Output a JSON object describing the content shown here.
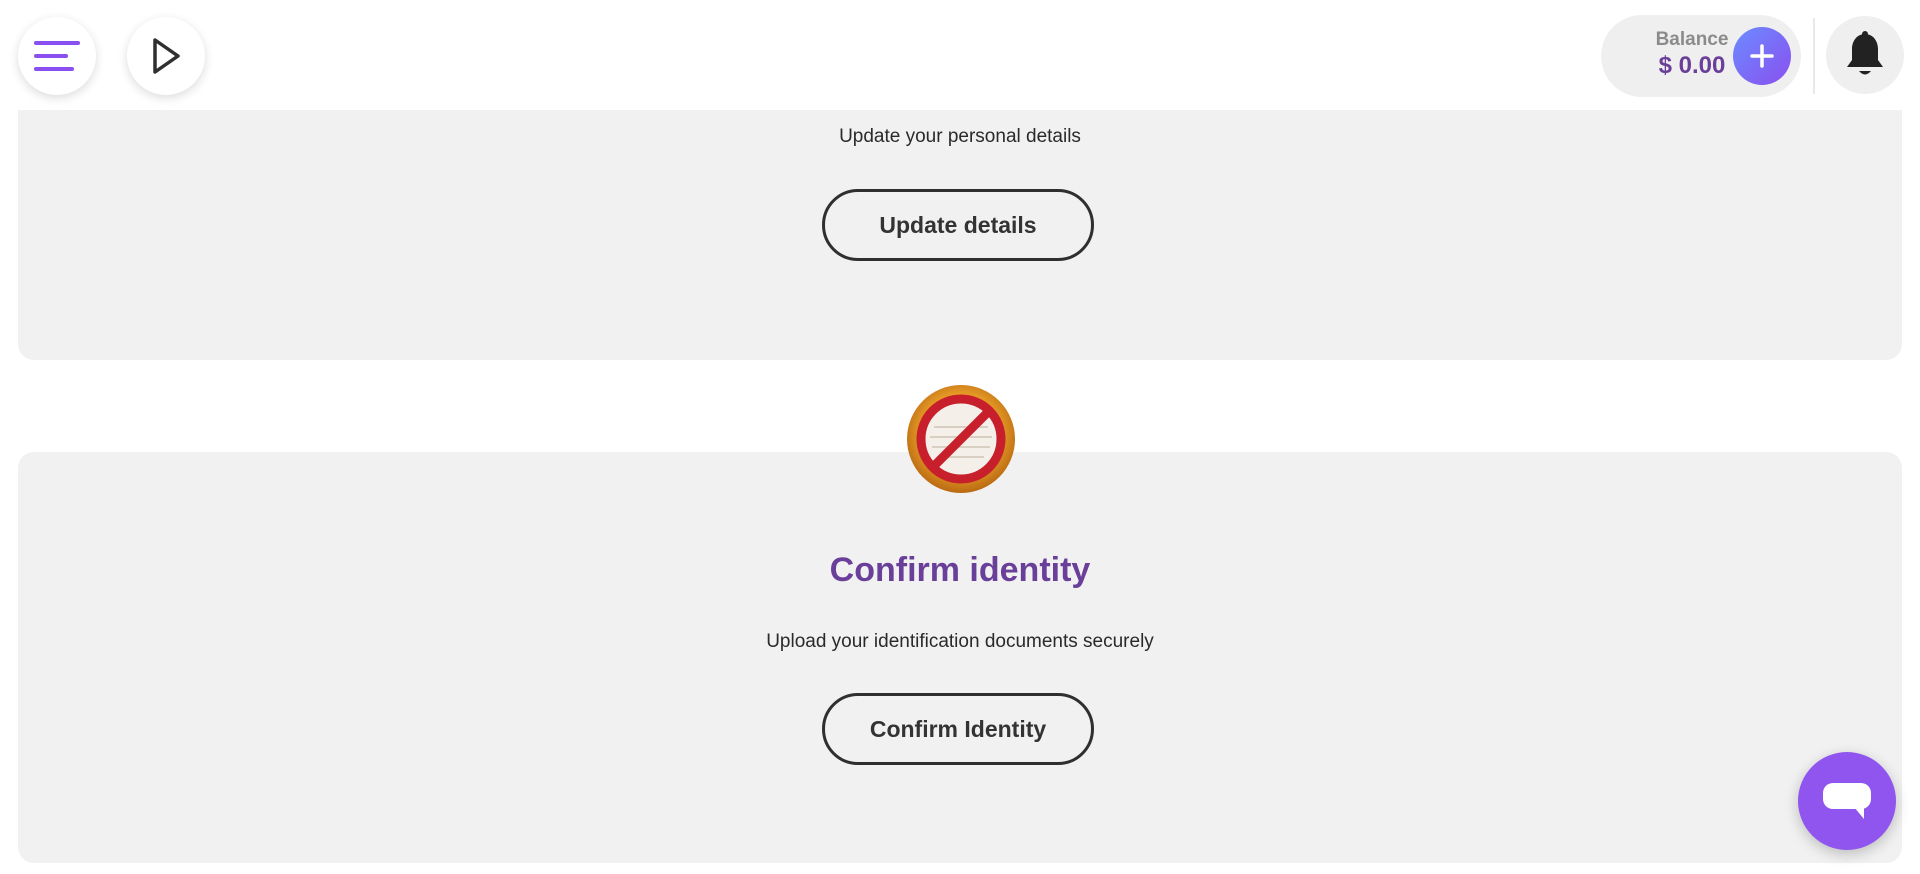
{
  "header": {
    "menu_icon": "menu-icon",
    "play_icon": "play-icon",
    "balance": {
      "label": "Balance",
      "value": "$ 0.00",
      "add_icon": "plus-icon"
    },
    "notification_icon": "bell-icon"
  },
  "details_card": {
    "description": "Update your personal details",
    "button_label": "Update details"
  },
  "identity_card": {
    "status_icon": "prohibited-document-icon",
    "title": "Confirm identity",
    "description": "Upload your identification documents securely",
    "button_label": "Confirm Identity"
  },
  "chat": {
    "icon": "chat-bubble-icon"
  },
  "colors": {
    "accent": "#6a3f99",
    "accent_button": "#8f55ee",
    "card_background": "#f1f1f1",
    "balance_label": "#8b8b8b"
  }
}
